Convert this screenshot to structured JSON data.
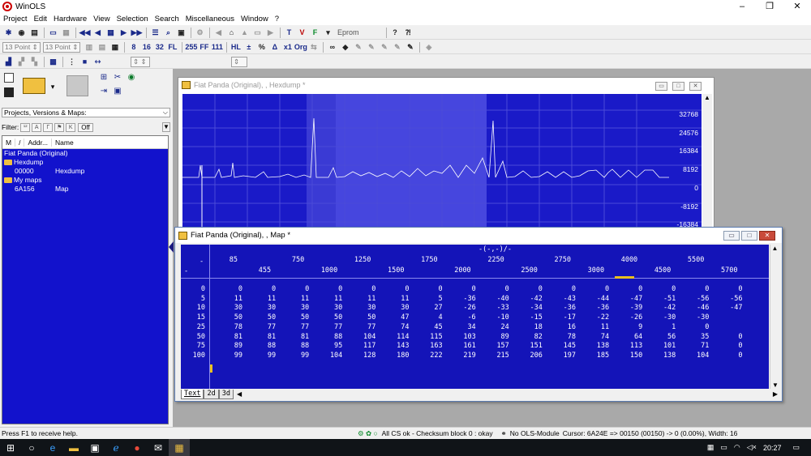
{
  "window": {
    "title": "WinOLS",
    "minimize": "–",
    "maximize": "❐",
    "close": "✕"
  },
  "menu": [
    "Project",
    "Edit",
    "Hardware",
    "View",
    "Selection",
    "Search",
    "Miscellaneous",
    "Window",
    "?"
  ],
  "toolbar": {
    "eprom_label": "Eprom",
    "font1": "13 Point",
    "font2": "13 Point",
    "btn_255": "255",
    "btn_ff": "FF",
    "btn_111": "111",
    "btn_percent": "%",
    "btn_delta": "Δ",
    "btn_x1": "x1",
    "btn_org": "Org"
  },
  "left_panel": {
    "projects_combo": "Projects, Versions & Maps:",
    "filter_label": "Filter:",
    "filter_off": "Off",
    "columns": [
      "M",
      "/",
      "Addr...",
      "Name"
    ],
    "tree": [
      {
        "text": "Fiat Panda (Original)",
        "kind": "root"
      },
      {
        "text": "Hexdump",
        "kind": "folder"
      },
      {
        "addr": "00000",
        "name": "Hexdump",
        "kind": "item"
      },
      {
        "text": "My maps",
        "kind": "folder"
      },
      {
        "addr": "6A156",
        "name": "Map",
        "kind": "item"
      }
    ]
  },
  "hexdump_window": {
    "title": "Fiat Panda (Original), , Hexdump *",
    "y_labels": [
      "32768",
      "24576",
      "16384",
      "8192",
      "0",
      "-8192",
      "-16384"
    ]
  },
  "map_window": {
    "title": "Fiat Panda (Original), , Map *",
    "axis_caption": "-(-,-)/-",
    "corner_top": "-",
    "corner_bottom": "-",
    "x_axis_top": [
      "85",
      "750",
      "1250",
      "1750",
      "2250",
      "2750",
      "4000",
      "5500"
    ],
    "x_axis_bottom": [
      "455",
      "1000",
      "1500",
      "2000",
      "2500",
      "3000",
      "4500",
      "5700"
    ],
    "row_headers": [
      "0",
      "5",
      "10",
      "15",
      "25",
      "50",
      "75",
      "100"
    ],
    "rows": [
      [
        "0",
        "0",
        "0",
        "0",
        "0",
        "0",
        "0",
        "0",
        "0",
        "0",
        "0",
        "0",
        "0",
        "0",
        "0",
        "0"
      ],
      [
        "11",
        "11",
        "11",
        "11",
        "11",
        "11",
        "5",
        "-36",
        "-40",
        "-42",
        "-43",
        "-44",
        "-47",
        "-51",
        "-56",
        "-56"
      ],
      [
        "30",
        "30",
        "30",
        "30",
        "30",
        "30",
        "27",
        "-26",
        "-33",
        "-34",
        "-36",
        "-36",
        "-39",
        "-42",
        "-46",
        "-47"
      ],
      [
        "50",
        "50",
        "50",
        "50",
        "50",
        "47",
        "4",
        "-6",
        "-10",
        "-15",
        "-17",
        "-22",
        "-26",
        "-30",
        "-30"
      ],
      [
        "78",
        "77",
        "77",
        "77",
        "77",
        "74",
        "45",
        "34",
        "24",
        "18",
        "16",
        "11",
        "9",
        "1",
        "0"
      ],
      [
        "81",
        "81",
        "81",
        "88",
        "104",
        "114",
        "115",
        "103",
        "89",
        "82",
        "78",
        "74",
        "64",
        "56",
        "35",
        "0"
      ],
      [
        "89",
        "88",
        "88",
        "95",
        "117",
        "143",
        "163",
        "161",
        "157",
        "151",
        "145",
        "138",
        "113",
        "101",
        "71",
        "0"
      ],
      [
        "99",
        "99",
        "99",
        "104",
        "128",
        "180",
        "222",
        "219",
        "215",
        "206",
        "197",
        "185",
        "150",
        "138",
        "104",
        "0"
      ]
    ],
    "tabs": [
      "Text",
      "2d",
      "3d"
    ]
  },
  "status_bar": {
    "help": "Press F1 to receive help.",
    "checksum": "All CS ok - Checksum block 0 : okay",
    "module": "No OLS-Module",
    "cursor": "Cursor: 6A24E => 00150 (00150) -> 0 (0.00%), Width: 16"
  },
  "taskbar": {
    "time": "20:27"
  },
  "colors": {
    "plot_bg": "#1a1ac8",
    "selection": "#4a4ae0",
    "grid_bg": "#1414b8",
    "tree_bg": "#1212cc"
  }
}
